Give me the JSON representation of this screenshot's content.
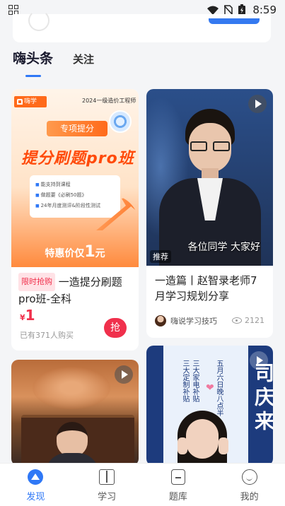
{
  "status_bar": {
    "time": "8:59"
  },
  "tabs": {
    "active": "嗨头条",
    "second": "关注"
  },
  "cards": [
    {
      "type": "product",
      "poster": {
        "brand": "嗨学",
        "course": "2024一级造价工程师",
        "subtag": "专项提分",
        "headline": "提分刷题pro班",
        "bullets": [
          "能支持到课程",
          "做题要《必刷50题》",
          "24年月度测评&阶段性测试"
        ],
        "promo_prefix": "特惠价仅",
        "promo_price": "1",
        "promo_suffix": "元"
      },
      "badge": "限时抢购",
      "title": "一造提分刷题pro班-全科",
      "price_currency": "¥",
      "price": "1",
      "buyers": "已有371人购买",
      "action": "抢"
    },
    {
      "type": "video",
      "subtitle": "各位同学 大家好",
      "badge": "推荐",
      "title": "一造篇丨赵智录老师7月学习规划分享",
      "author": "嗨说学习技巧",
      "views": "2121"
    },
    {
      "type": "video"
    },
    {
      "type": "video",
      "vertical_lines": [
        "五月六日晚八点半",
        "三大家电补贴",
        "三大定制补贴"
      ],
      "big_text": "司庆来"
    }
  ],
  "bottom_nav": [
    {
      "label": "发现",
      "icon": "discover-icon",
      "active": true
    },
    {
      "label": "学习",
      "icon": "book-icon",
      "active": false
    },
    {
      "label": "题库",
      "icon": "question-bank-icon",
      "active": false
    },
    {
      "label": "我的",
      "icon": "profile-icon",
      "active": false
    }
  ],
  "colors": {
    "accent": "#2f78f6",
    "price": "#f0304c",
    "promo_orange": "#ff6a1a"
  }
}
